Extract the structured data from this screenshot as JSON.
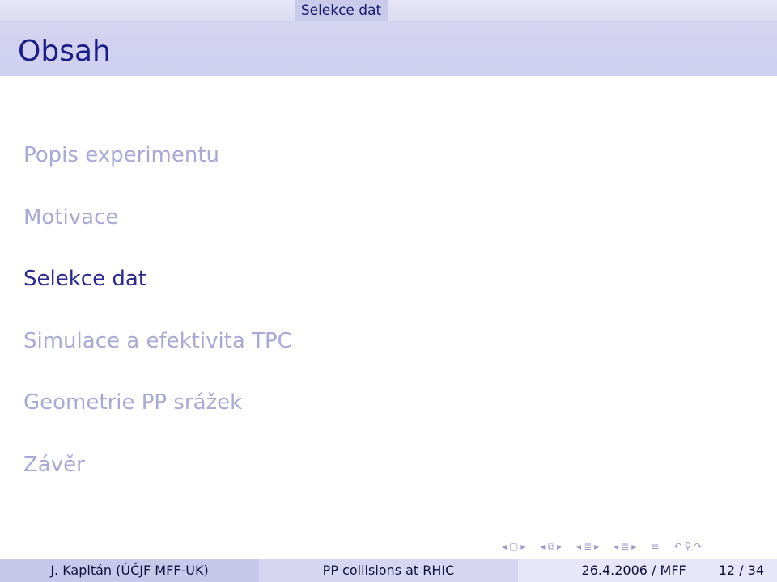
{
  "header": {
    "section": "Selekce dat"
  },
  "frame": {
    "title": "Obsah"
  },
  "toc": {
    "items": [
      {
        "label": "Popis experimentu"
      },
      {
        "label": "Motivace"
      },
      {
        "label": "Selekce dat"
      },
      {
        "label": "Simulace a efektivita TPC"
      },
      {
        "label": "Geometrie PP srážek"
      },
      {
        "label": "Závěr"
      }
    ],
    "current_index": 2
  },
  "nav": {
    "icons": [
      "nav-left-arrow",
      "frame-icon",
      "nav-right-arrow",
      "nav-left-arrow",
      "subsection-icon",
      "nav-right-arrow",
      "nav-left-arrow",
      "section-icon",
      "nav-right-arrow",
      "nav-left-arrow",
      "section-icon",
      "nav-right-arrow",
      "align-icon",
      "undo-icon",
      "search-icon",
      "redo-icon"
    ]
  },
  "footer": {
    "author": "J. Kapitán  (ÚČJF MFF-UK)",
    "talk_title": "PP collisions at RHIC",
    "date": "26.4.2006 / MFF",
    "page": "12 / 34"
  },
  "colors": {
    "accent": "#1d1d88",
    "inactive": "#a9a9d6",
    "bar_dark": "#c8c8ea",
    "bar_mid": "#d6d6f2",
    "bar_light": "#e6e6f8"
  }
}
